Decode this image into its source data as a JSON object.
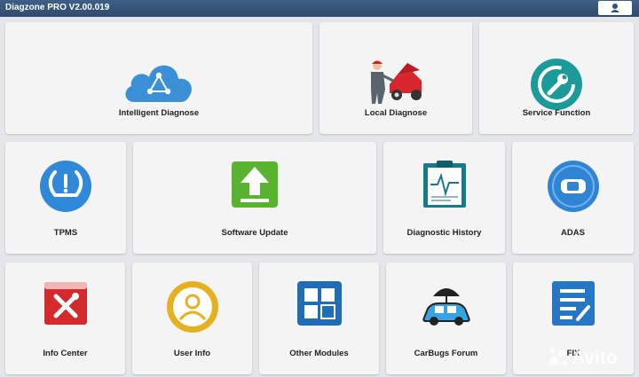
{
  "header": {
    "title": "Diagzone PRO V2.00.019",
    "user_icon": "user-icon"
  },
  "tiles": [
    {
      "label": "Intelligent Diagnose",
      "icon": "cloud-share-icon"
    },
    {
      "label": "Local Diagnose",
      "icon": "mechanic-car-icon"
    },
    {
      "label": "Service Function",
      "icon": "wrench-reset-icon"
    },
    {
      "label": "TPMS",
      "icon": "tpms-icon"
    },
    {
      "label": "Software Update",
      "icon": "upload-arrow-icon"
    },
    {
      "label": "Diagnostic History",
      "icon": "clipboard-graph-icon"
    },
    {
      "label": "ADAS",
      "icon": "adas-car-icon"
    },
    {
      "label": "Info Center",
      "icon": "toolbox-icon"
    },
    {
      "label": "User Info",
      "icon": "user-badge-icon"
    },
    {
      "label": "Other Modules",
      "icon": "modules-grid-icon"
    },
    {
      "label": "CarBugs Forum",
      "icon": "car-umbrella-icon"
    },
    {
      "label": "FIX",
      "icon": "fix-list-icon"
    }
  ],
  "watermark": {
    "text": "Avito"
  },
  "colors": {
    "header": "#33507a",
    "tile": "#f4f4f4",
    "background": "#e4e6e9"
  }
}
